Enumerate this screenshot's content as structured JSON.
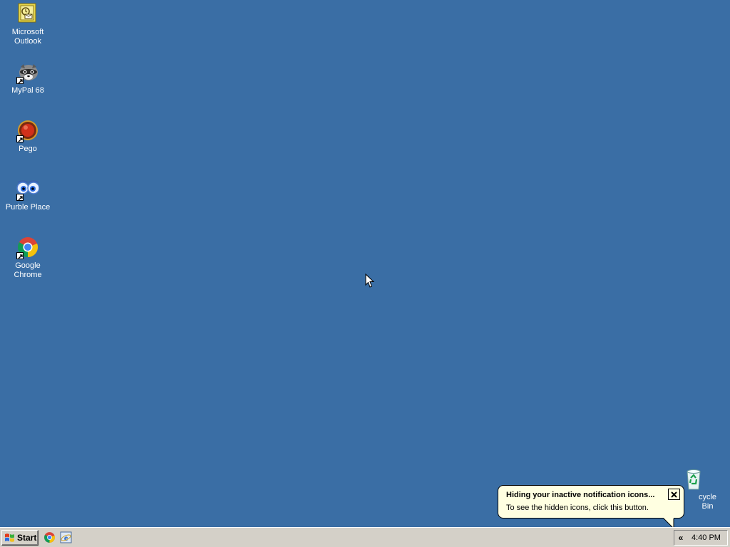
{
  "desktop": {
    "background_color": "#3a6ea5",
    "icons": [
      {
        "label": "Microsoft\nOutlook",
        "line1": "Microsoft",
        "line2": "Outlook",
        "icon": "outlook-icon"
      },
      {
        "label": "MyPal 68",
        "icon": "mypal-icon"
      },
      {
        "label": "Pego",
        "icon": "pego-icon"
      },
      {
        "label": "Purble Place",
        "icon": "purble-place-icon"
      },
      {
        "label": "Google Chrome",
        "icon": "chrome-icon"
      },
      {
        "label": "cycle Bin",
        "icon": "recycle-bin-icon"
      }
    ]
  },
  "taskbar": {
    "start_label": "Start",
    "quick_launch": [
      "chrome-icon",
      "ie-icon"
    ],
    "tray_expand_label": "«",
    "clock": "4:40 PM"
  },
  "balloon": {
    "title": "Hiding your inactive notification icons...",
    "text": "To see the hidden icons, click this button."
  }
}
